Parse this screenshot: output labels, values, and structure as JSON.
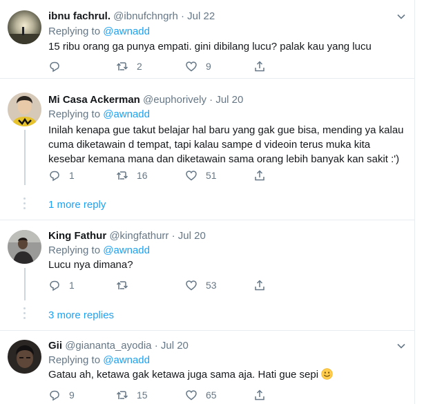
{
  "tweets": [
    {
      "name": "ibnu fachrul.",
      "handle": "@ibnufchngrh",
      "dot": "·",
      "date": "Jul 22",
      "replying_prefix": "Replying to ",
      "replying_to": "@awnadd",
      "text": "15 ribu orang ga punya empati. gini dibilang lucu? palak kau yang lucu",
      "replies": "",
      "retweets": "2",
      "likes": "9"
    },
    {
      "name": "Mi Casa Ackerman",
      "handle": "@euphorively",
      "dot": "·",
      "date": "Jul 20",
      "replying_prefix": "Replying to ",
      "replying_to": "@awnadd",
      "text": "Inilah kenapa gue takut belajar hal baru yang gak gue bisa, mending ya kalau cuma diketawain d tempat, tapi kalau sampe d videoin terus muka kita kesebar kemana mana dan diketawain sama orang lebih banyak kan sakit :')",
      "replies": "1",
      "retweets": "16",
      "likes": "51"
    },
    {
      "name": "King Fathur",
      "handle": "@kingfathurr",
      "dot": "·",
      "date": "Jul 20",
      "replying_prefix": "Replying to ",
      "replying_to": "@awnadd",
      "text": "Lucu nya dimana?",
      "replies": "1",
      "retweets": "",
      "likes": "53"
    },
    {
      "name": "Gii",
      "handle": "@giananta_ayodia",
      "dot": "·",
      "date": "Jul 20",
      "replying_prefix": "Replying to ",
      "replying_to": "@awnadd",
      "text": "Gatau ah, ketawa gak ketawa juga sama aja. Hati gue sepi",
      "emoji": "slightly-smiling-face-emoji",
      "replies": "9",
      "retweets": "15",
      "likes": "65"
    }
  ],
  "more_links": {
    "first": "1 more reply",
    "second": "3 more replies"
  },
  "colors": {
    "accent": "#1da1f2",
    "muted": "#657786",
    "border": "#e6ecf0"
  },
  "icons": {
    "reply": "reply-icon",
    "retweet": "retweet-icon",
    "like": "heart-icon",
    "share": "share-icon",
    "caret": "chevron-down-icon"
  }
}
